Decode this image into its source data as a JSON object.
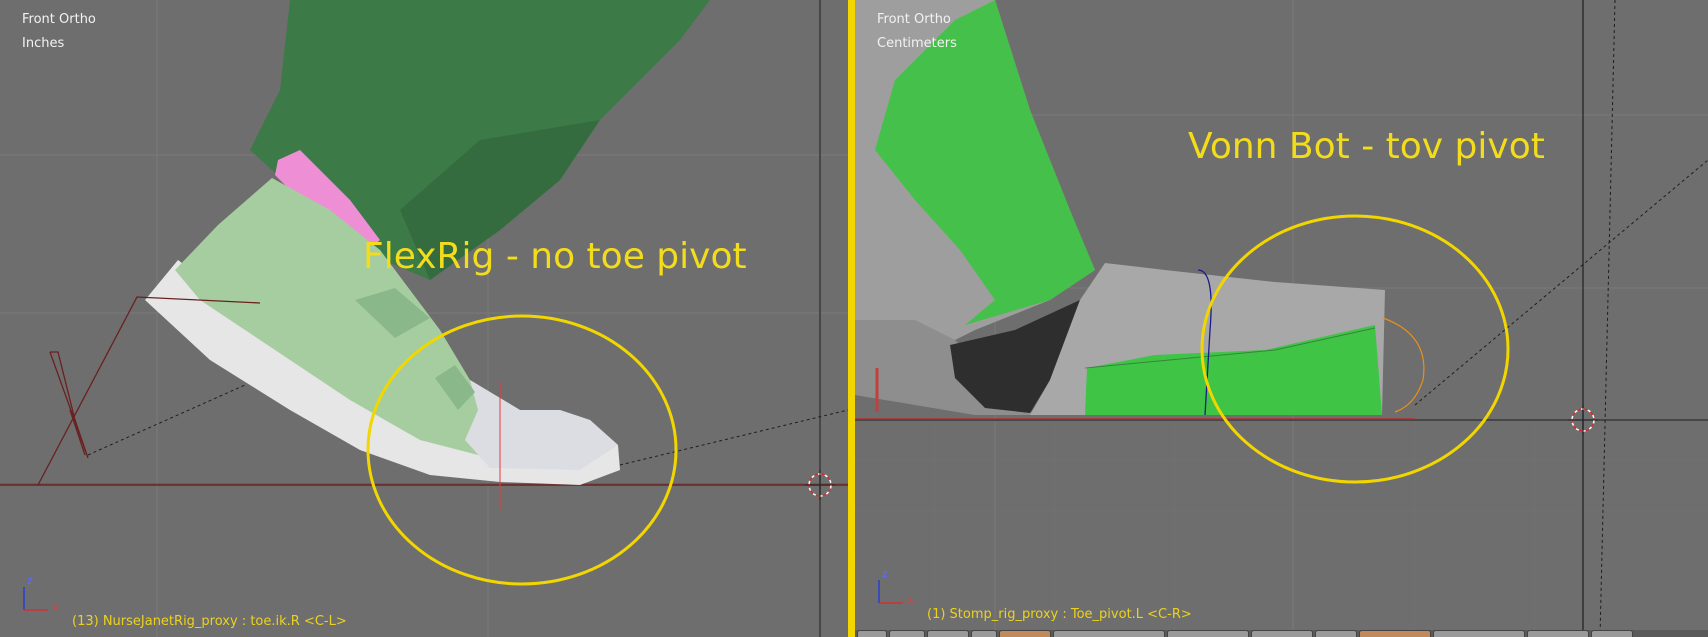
{
  "left_viewport": {
    "view_label": "Front Ortho",
    "units_label": "Inches",
    "annotation": "FlexRig - no toe pivot",
    "status": "(13) NurseJanetRig_proxy : toe.ik.R <C-L>",
    "axis_z": "z",
    "axis_x": "x"
  },
  "right_viewport": {
    "view_label": "Front Ortho",
    "units_label": "Centimeters",
    "annotation": "Vonn Bot - tov pivot",
    "status": "(1) Stomp_rig_proxy : Toe_pivot.L <C-R>",
    "axis_z": "z",
    "axis_x": "x"
  },
  "colors": {
    "annotation": "#f3dc1c",
    "divider": "#f2d600",
    "viewport_bg": "#6e6e6e"
  },
  "icons": [
    "3d-cursor-icon",
    "axis-gizmo-icon"
  ]
}
